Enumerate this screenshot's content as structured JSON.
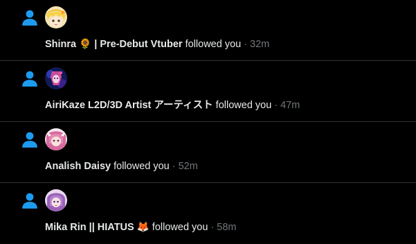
{
  "colors": {
    "background": "#000000",
    "accent": "#1d9bf0",
    "text": "#e7e9ea",
    "muted": "#71767b",
    "divider": "#2f3336"
  },
  "notifications": [
    {
      "icon": "person-icon",
      "name": "Shinra 🌻 | Pre-Debut Vtuber",
      "action": " followed you",
      "time": " · 32m"
    },
    {
      "icon": "person-icon",
      "name": "AiriKaze L2D/3D Artist アーティスト",
      "action": " followed you",
      "time": " · 47m"
    },
    {
      "icon": "person-icon",
      "name": "Analish Daisy",
      "action": " followed you",
      "time": " · 52m"
    },
    {
      "icon": "person-icon",
      "name": "Mika Rin || HIATUS 🦊",
      "action": " followed you",
      "time": " · 58m"
    }
  ]
}
